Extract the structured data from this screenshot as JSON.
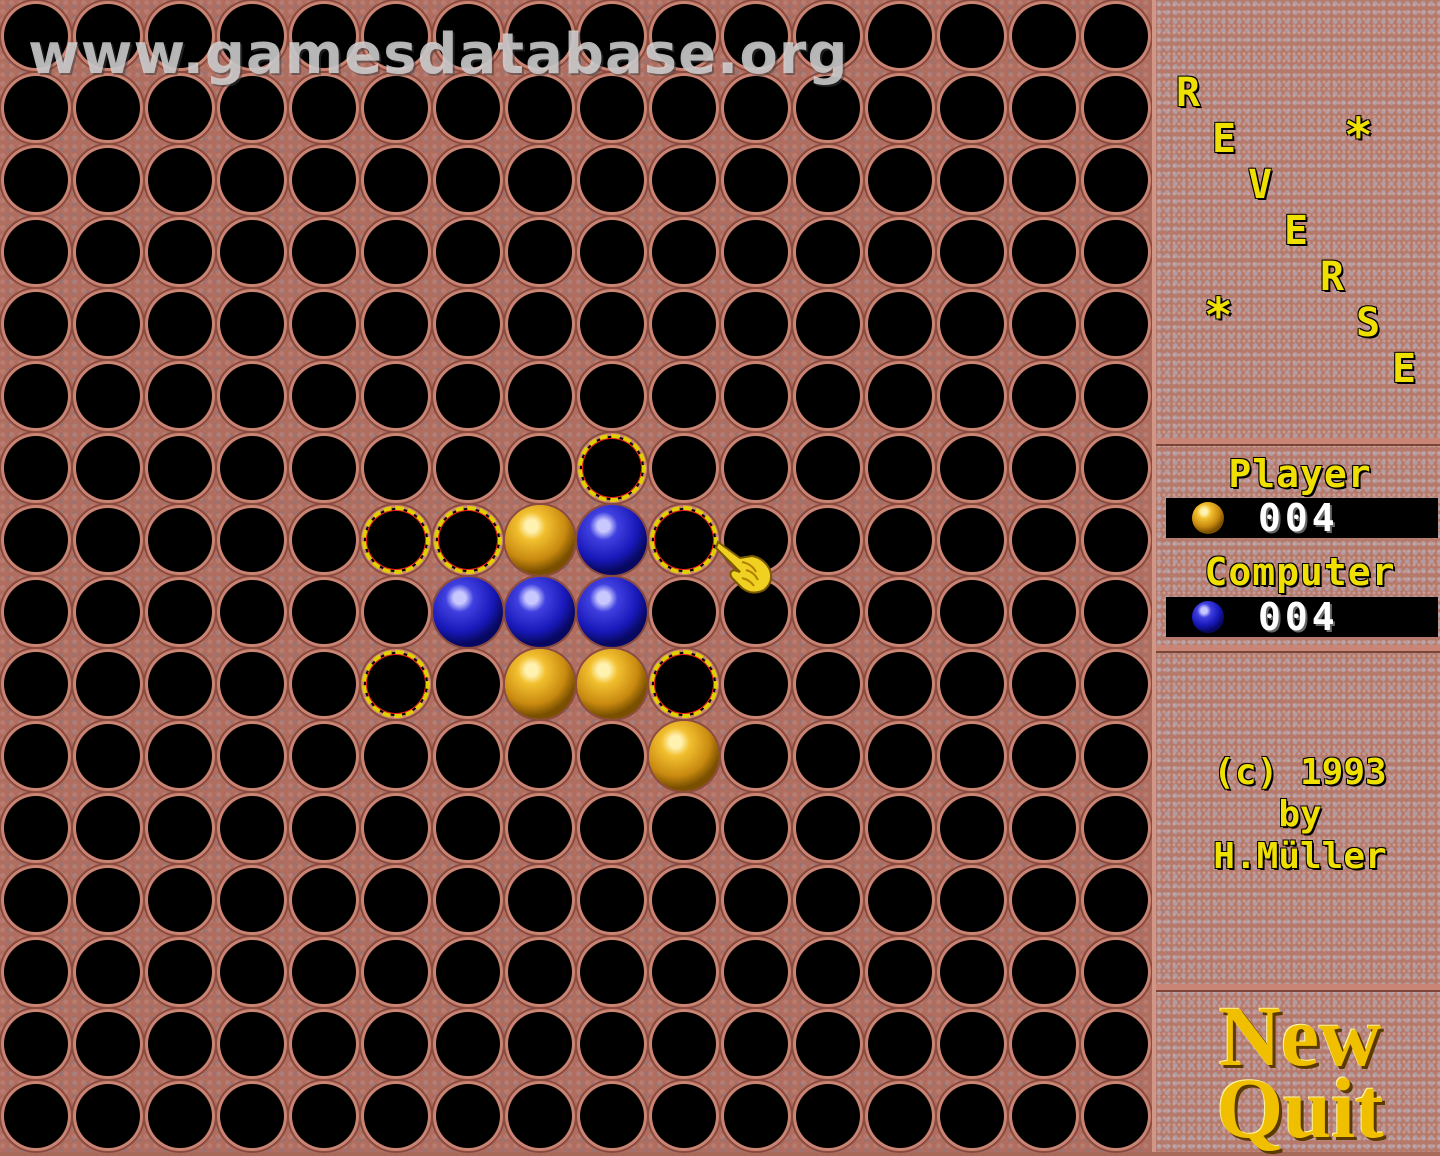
{
  "watermark": "www.gamesdatabase.org",
  "board": {
    "rows": 16,
    "cols": 16,
    "player_pieces": [
      [
        7,
        7
      ],
      [
        9,
        7
      ],
      [
        9,
        8
      ],
      [
        10,
        9
      ]
    ],
    "computer_pieces": [
      [
        7,
        8
      ],
      [
        8,
        6
      ],
      [
        8,
        7
      ],
      [
        8,
        8
      ]
    ],
    "valid_moves": [
      [
        6,
        8
      ],
      [
        7,
        5
      ],
      [
        7,
        6
      ],
      [
        7,
        9
      ],
      [
        9,
        5
      ],
      [
        9,
        9
      ]
    ]
  },
  "sidebar": {
    "title_letters": [
      "R",
      "E",
      "V",
      "E",
      "R",
      "S",
      "E"
    ],
    "decor_symbol": "*",
    "player_label": "Player",
    "player_score": "004",
    "computer_label": "Computer",
    "computer_score": "004",
    "credit_line1": "(c) 1993",
    "credit_line2": "by",
    "credit_line3": "H.Müller",
    "new_label": "New",
    "quit_label": "Quit"
  },
  "colors": {
    "player": "#e0a820",
    "computer": "#1c1cc8",
    "text_yellow": "#f0e000",
    "highlight": "#e0d000"
  },
  "icons": {
    "cursor": "pointing-hand-icon"
  }
}
